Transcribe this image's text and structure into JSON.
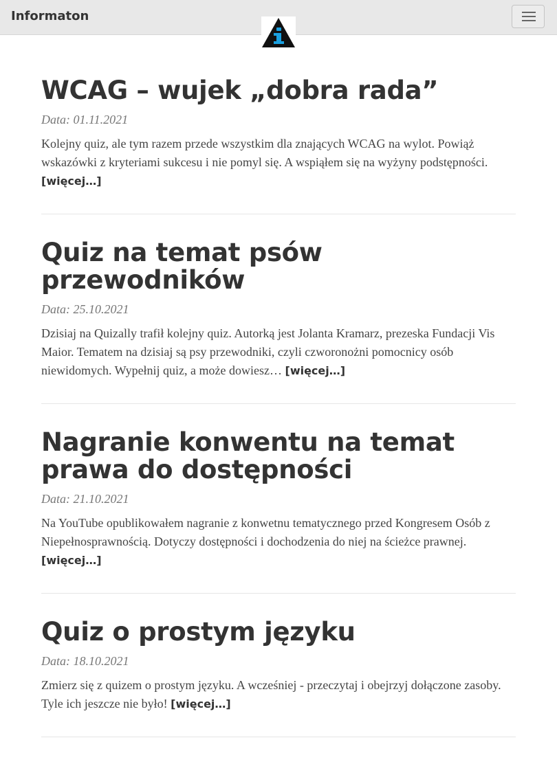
{
  "header": {
    "brand": "Informaton",
    "menu_button": "menu-toggle"
  },
  "colors": {
    "navbar_bg": "#e8e8e8",
    "logo_accent": "#1aa0e0"
  },
  "posts": [
    {
      "title": "WCAG – wujek „dobra rada”",
      "date": "Data: 01.11.2021",
      "excerpt": "Kolejny quiz, ale tym razem przede wszystkim dla znających WCAG na wylot. Powiąż wskazówki z kryteriami sukcesu i nie pomyl się. A wspiąłem się na wyżyny podstępności.",
      "more": "[więcej…]"
    },
    {
      "title": "Quiz na temat psów przewodników",
      "date": "Data: 25.10.2021",
      "excerpt": "Dzisiaj na Quizally trafił kolejny quiz. Autorką jest Jolanta Kramarz, prezeska Fundacji Vis Maior. Tematem na dzisiaj są psy przewodniki, czyli czworonożni pomocnicy osób niewidomych. Wypełnij quiz, a może dowiesz…",
      "more": "[więcej…]"
    },
    {
      "title": "Nagranie konwentu na temat prawa do dostępności",
      "date": "Data: 21.10.2021",
      "excerpt": "Na YouTube opublikowałem nagranie z konwetnu tematycznego przed Kongresem Osób z Niepełnosprawnością. Dotyczy dostępności i dochodzenia do niej na ścieżce prawnej.",
      "more": "[więcej…]"
    },
    {
      "title": "Quiz o prostym języku",
      "date": "Data: 18.10.2021",
      "excerpt": "Zmierz się z quizem o prostym języku. A wcześniej - przeczytaj i obejrzyj dołączone zasoby. Tyle ich jeszcze nie było!",
      "more": "[więcej…]"
    }
  ]
}
